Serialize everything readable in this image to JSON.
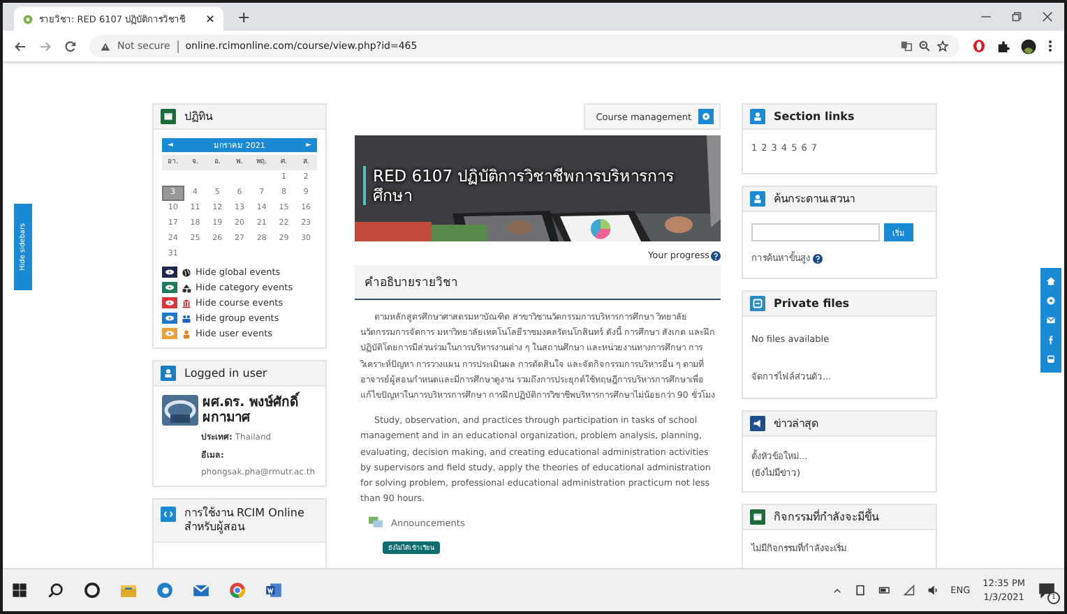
{
  "browser": {
    "tab_title": "รายวิชา: RED 6107 ปฏิบัติการวิชาชี",
    "new_tab": "+",
    "security": "Not secure",
    "url": "online.rcimonline.com/course/view.php?id=465"
  },
  "sidebar_toggle": "Hide sidebars",
  "calendar": {
    "title": "ปฏิทิน",
    "prev": "◄",
    "month": "มกราคม 2021",
    "next": "►",
    "weekdays": [
      "อา.",
      "จ.",
      "อ.",
      "พ.",
      "พฤ.",
      "ศ.",
      "ส."
    ],
    "weeks": [
      {
        "kind": "partial_start",
        "days": [
          {
            "day": "1",
            "selected": false
          },
          {
            "day": "2",
            "selected": false
          }
        ]
      },
      {
        "kind": "full",
        "days": [
          {
            "day": "3",
            "selected": true
          },
          {
            "day": "4",
            "selected": false
          },
          {
            "day": "5",
            "selected": false
          },
          {
            "day": "6",
            "selected": false
          },
          {
            "day": "7",
            "selected": false
          },
          {
            "day": "8",
            "selected": false
          },
          {
            "day": "9",
            "selected": false
          }
        ]
      },
      {
        "kind": "full",
        "days": [
          {
            "day": "10",
            "selected": false
          },
          {
            "day": "11",
            "selected": false
          },
          {
            "day": "12",
            "selected": false
          },
          {
            "day": "13",
            "selected": false
          },
          {
            "day": "14",
            "selected": false
          },
          {
            "day": "15",
            "selected": false
          },
          {
            "day": "16",
            "selected": false
          }
        ]
      },
      {
        "kind": "full",
        "days": [
          {
            "day": "17",
            "selected": false
          },
          {
            "day": "18",
            "selected": false
          },
          {
            "day": "19",
            "selected": false
          },
          {
            "day": "20",
            "selected": false
          },
          {
            "day": "21",
            "selected": false
          },
          {
            "day": "22",
            "selected": false
          },
          {
            "day": "23",
            "selected": false
          }
        ]
      },
      {
        "kind": "full",
        "days": [
          {
            "day": "24",
            "selected": false
          },
          {
            "day": "25",
            "selected": false
          },
          {
            "day": "26",
            "selected": false
          },
          {
            "day": "27",
            "selected": false
          },
          {
            "day": "28",
            "selected": false
          },
          {
            "day": "29",
            "selected": false
          },
          {
            "day": "30",
            "selected": false
          }
        ]
      },
      {
        "kind": "partial_end",
        "days": [
          {
            "day": "31",
            "selected": false
          }
        ]
      }
    ],
    "event_filters": [
      {
        "kind": "global",
        "label": "Hide global events",
        "color": "#1c2650"
      },
      {
        "kind": "category",
        "label": "Hide category events",
        "color": "#1f7a5c"
      },
      {
        "kind": "course",
        "label": "Hide course events",
        "color": "#d9363e"
      },
      {
        "kind": "group",
        "label": "Hide group events",
        "color": "#1f78c8"
      },
      {
        "kind": "user",
        "label": "Hide user events",
        "color": "#e8a33a"
      }
    ]
  },
  "logged_in": {
    "title": "Logged in user",
    "name": "ผศ.ดร. พงษ์ศักดิ์ ผกามาศ",
    "fields": [
      {
        "kind": "inline",
        "label": "ประเทศ:",
        "value": "Thailand"
      },
      {
        "kind": "stacked",
        "label": "อีเมล:",
        "value": "phongsak.pha@rmutr.ac.th"
      }
    ]
  },
  "guide_block": {
    "title": "การใช้งาน RCIM Online สำหรับผู้สอน"
  },
  "course": {
    "manage_button": "Course management",
    "title": "RED 6107 ปฏิบัติการวิชาชีพการบริหารการศึกษา",
    "progress": "Your progress",
    "section_title": "คำอธิบายรายวิชา",
    "paragraphs": [
      "ตามหลักสูตรศึกษาศาสตรมหาบัณฑิต สาขาวิชานวัตกรรมการบริหารการศึกษา วิทยาลัยนวัตกรรมการจัดการ มหาวิทยาลัยเทคโนโลยีราชมงคลรัตนโกสินทร์ ดังนี้ การศึกษา สังเกต และฝึกปฏิบัติโดยการมีส่วนร่วมในการบริหารงานต่าง ๆ ในสถานศึกษา และหน่วยงานทางการศึกษา การวิเคราะห์ปัญหา การวางแผน การประเมินผล การตัดสินใจ และจัดกิจกรรมการบริหารอื่น ๆ ตามที่อาจารย์ผู้สอนกำหนดและมีการศึกษาดูงาน รวมถึงการประยุกต์ใช้ทฤษฎีการบริหารการศึกษาเพื่อแก้ไขปัญหาในการบริหารการศึกษา การฝึกปฏิบัติการวิชาชีพบริหารการศึกษาไม่น้อยกว่า 90 ชั่วโมง",
      "Study, observation, and practices through participation in tasks of school management and in an educational organization, problem analysis, planning, evaluating, decision making, and creating educational administration activities by supervisors and field study, apply the theories of educational administration for solving problem, professional educational administration practicum not less than 90 hours."
    ],
    "activity": "Announcements",
    "badge": "ยังไม่ได้เข้าเรียน"
  },
  "section_links": {
    "title": "Section links",
    "links": [
      "1",
      "2",
      "3",
      "4",
      "5",
      "6",
      "7"
    ]
  },
  "forum_search": {
    "title": "ค้นกระดานเสวนา",
    "button": "เริ่ม",
    "advanced": "การค้นหาขั้นสูง"
  },
  "private_files": {
    "title": "Private files",
    "empty": "No files available",
    "manage": "จัดการไฟล์ส่วนตัว..."
  },
  "news": {
    "title": "ข่าวล่าสุด",
    "lines": [
      {
        "kind": "link",
        "text": "ตั้งหัวข้อใหม่..."
      },
      {
        "kind": "text",
        "text": "(ยังไม่มีข่าว)"
      }
    ]
  },
  "upcoming": {
    "title": "กิจกรรมที่กำลังจะมีขึ้น",
    "empty": "ไม่มีกิจกรรมที่กำลังจะเริ่ม"
  },
  "taskbar": {
    "language": "ENG",
    "time": "12:35 PM",
    "date": "1/3/2021",
    "notifications": "1"
  }
}
